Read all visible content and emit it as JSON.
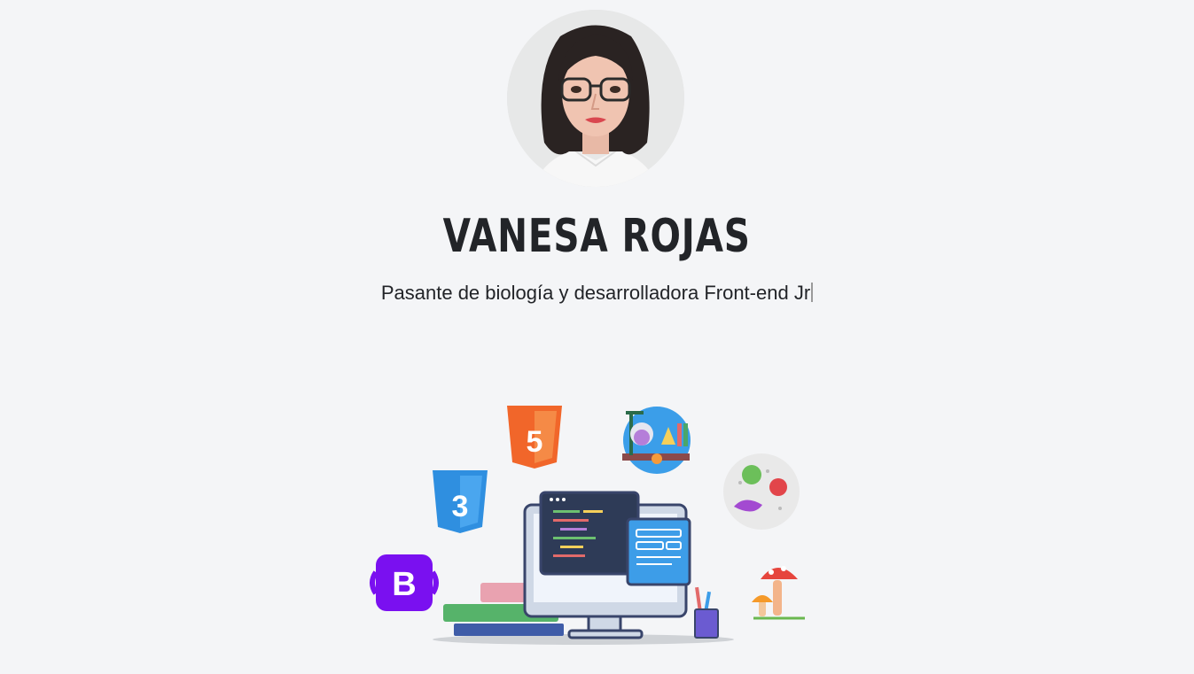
{
  "profile": {
    "name": "VANESA ROJAS",
    "subtitle": "Pasante de biología y desarrolladora Front-end Jr"
  },
  "illustration": {
    "bootstrap_letter": "B",
    "html_badge_number": "5",
    "css_badge_number": "3",
    "icons": [
      "html5-icon",
      "css3-icon",
      "bootstrap-icon",
      "laboratory-flask-icon",
      "bacteria-icon",
      "mushroom-icon",
      "computer-monitor-icon",
      "books-icon",
      "pencil-cup-icon"
    ]
  },
  "colors": {
    "background": "#f4f5f7",
    "text": "#222428",
    "html5": "#f1662a",
    "css3": "#2f8fe0",
    "bootstrap": "#7a10f0"
  }
}
